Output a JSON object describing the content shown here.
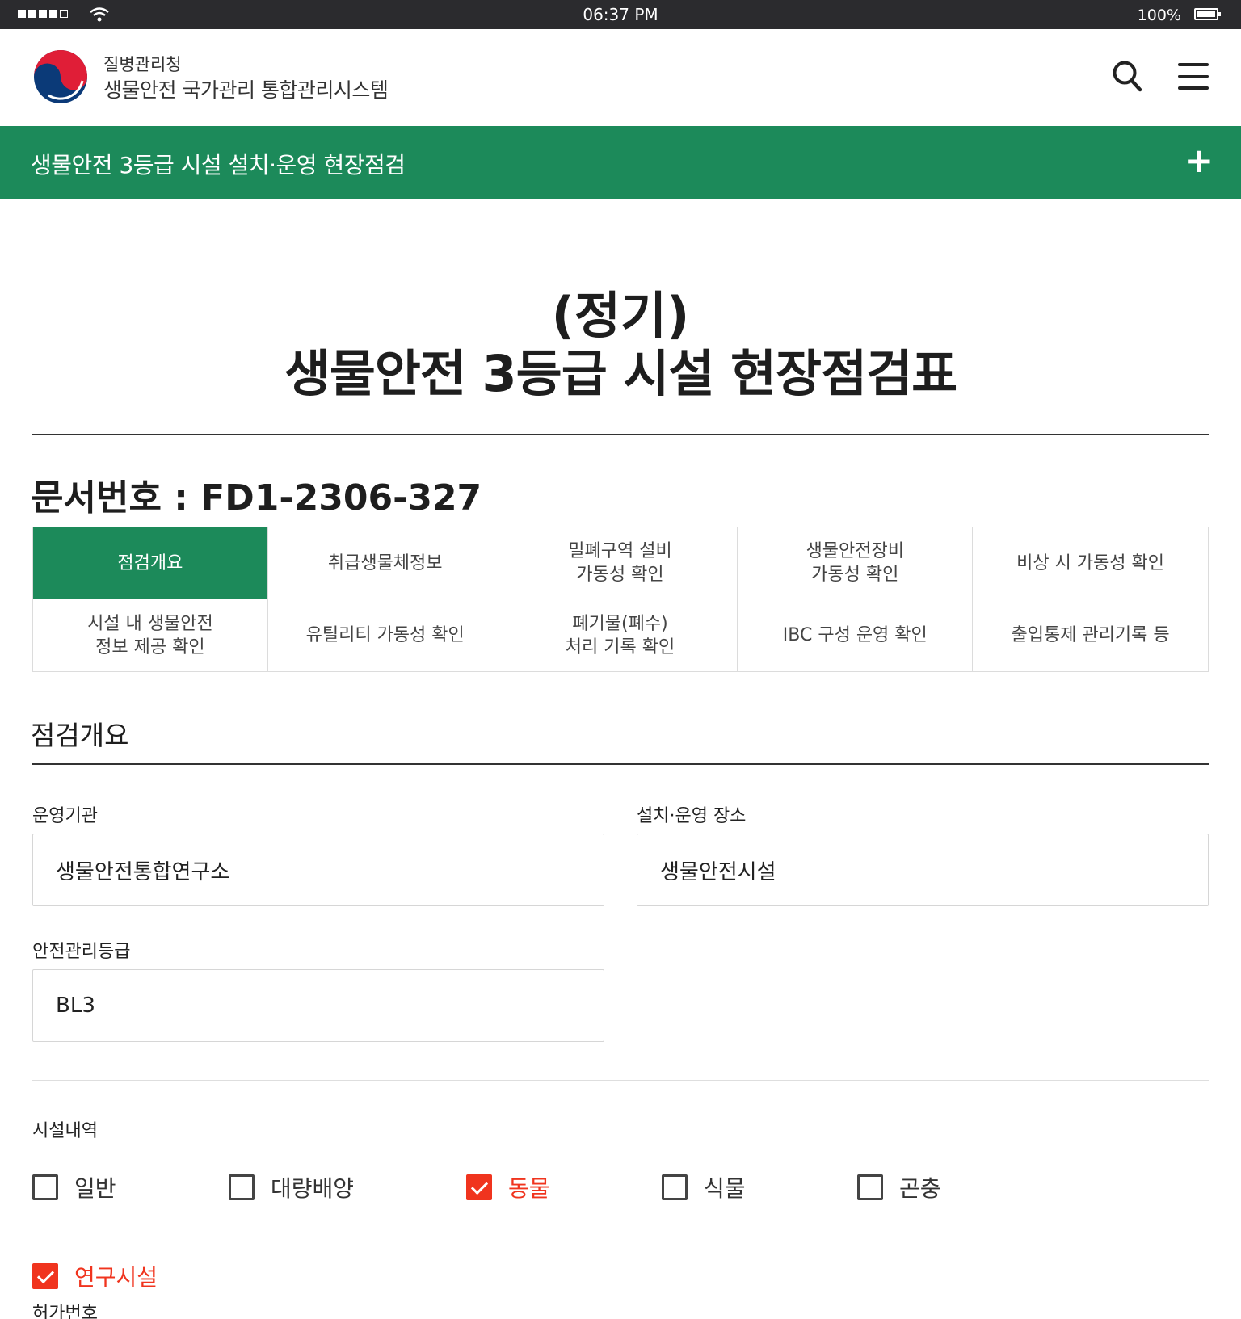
{
  "status_bar": {
    "time": "06:37 PM",
    "battery": "100%"
  },
  "header": {
    "agency": "질병관리청",
    "system": "생물안전 국가관리 통합관리시스템"
  },
  "banner": {
    "label": "생물안전 3등급 시설 설치·운영 현장점검",
    "expand_icon": "plus-icon"
  },
  "page": {
    "title_line1": "(정기)",
    "title_line2": "생물안전 3등급 시설 현장점검표",
    "doc_number": "문서번호 : FD1-2306-327"
  },
  "tabs": [
    {
      "label": "점검개요",
      "active": true
    },
    {
      "label": "취급생물체정보"
    },
    {
      "label": "밀폐구역 설비\n가동성 확인"
    },
    {
      "label": "생물안전장비\n가동성 확인"
    },
    {
      "label": "비상 시 가동성 확인"
    },
    {
      "label": "시설 내 생물안전\n정보 제공 확인"
    },
    {
      "label": "유틸리티 가동성 확인"
    },
    {
      "label": "폐기물(폐수)\n처리 기록 확인"
    },
    {
      "label": "IBC 구성 운영 확인"
    },
    {
      "label": "출입통제 관리기록 등"
    }
  ],
  "section": {
    "title": "점검개요",
    "fields": {
      "org_label": "운영기관",
      "org_value": "생물안전통합연구소",
      "location_label": "설치·운영 장소",
      "location_value": "생물안전시설",
      "grade_label": "안전관리등급",
      "grade_value": "BL3"
    },
    "facility_label": "시설내역",
    "facility_options": [
      {
        "label": "일반",
        "checked": false
      },
      {
        "label": "대량배양",
        "checked": false
      },
      {
        "label": "동물",
        "checked": true
      },
      {
        "label": "식물",
        "checked": false
      },
      {
        "label": "곤충",
        "checked": false
      },
      {
        "label": "연구시설",
        "checked": true
      }
    ],
    "permit_label": "허가번호"
  },
  "colors": {
    "primary_green": "#1c8a5a",
    "check_red": "#f0341e"
  }
}
